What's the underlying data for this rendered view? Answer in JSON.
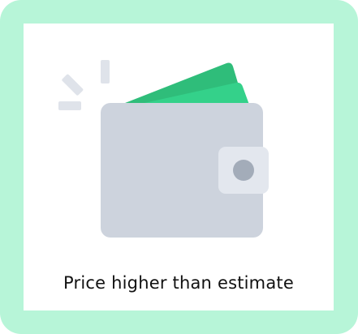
{
  "card": {
    "caption": "Price higher than estimate",
    "icon": "wallet-icon"
  },
  "colors": {
    "frame": "#b7f5d8",
    "background": "#ffffff",
    "wallet_body": "#cdd3dd",
    "wallet_clasp": "#e3e7ee",
    "wallet_button": "#a3acb9",
    "bill_front": "#34d18a",
    "bill_back": "#2fbd7a",
    "spark_lines": "#dfe3ea",
    "text": "#111111"
  }
}
